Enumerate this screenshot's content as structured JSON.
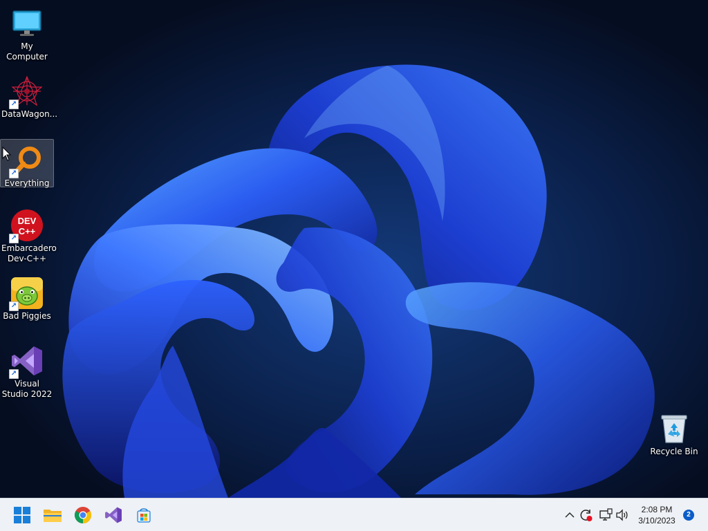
{
  "desktop": {
    "icons": [
      {
        "label": "My Computer",
        "icon": "monitor-icon"
      },
      {
        "label": "DataWagon...",
        "icon": "datawagon-icon"
      },
      {
        "label": "Everything",
        "icon": "everything-search-icon"
      },
      {
        "label": "Embarcadero Dev-C++",
        "icon": "devcpp-icon",
        "badge": "DEV C++"
      },
      {
        "label": "Bad Piggies",
        "icon": "bad-piggies-icon"
      },
      {
        "label": "Visual Studio 2022",
        "icon": "visual-studio-icon"
      },
      {
        "label": "Recycle Bin",
        "icon": "recycle-bin-icon"
      }
    ]
  },
  "taskbar": {
    "pinned": [
      "start-icon",
      "file-explorer-icon",
      "chrome-icon",
      "visual-studio-icon",
      "store-icon"
    ],
    "tray": [
      "chevron-up-icon",
      "update-icon",
      "network-icon",
      "volume-icon"
    ],
    "clock": {
      "time": "2:08 PM",
      "date": "3/10/2023"
    },
    "notifications": "2"
  },
  "colors": {
    "taskbar_bg": "#eef1f5",
    "accent": "#0b5cc8",
    "wallpaper_blue": "#1f4fd8"
  }
}
